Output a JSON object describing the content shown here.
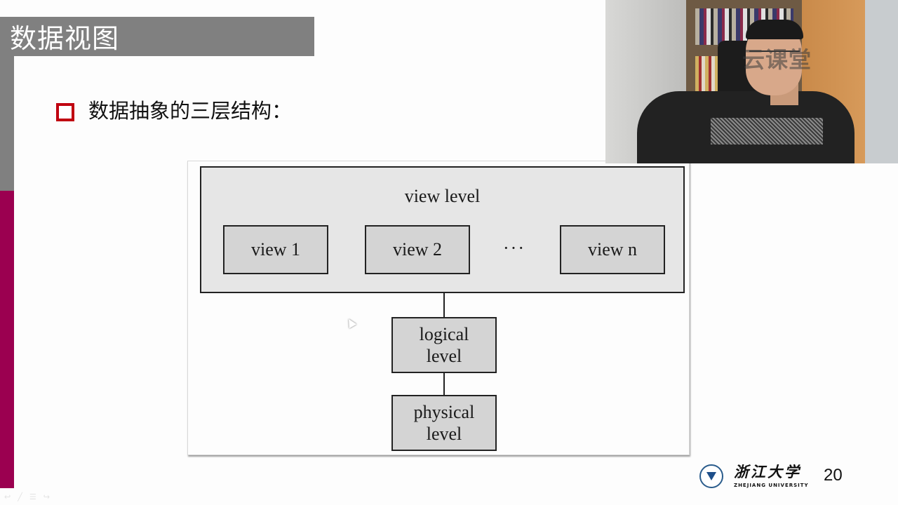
{
  "slide": {
    "title": "数据视图",
    "bullet": "数据抽象的三层结构：",
    "page_number": "20"
  },
  "figure": {
    "view_level_label": "view level",
    "views": [
      "view 1",
      "view 2",
      "view n"
    ],
    "ellipsis": "···",
    "logical_level": [
      "logical",
      "level"
    ],
    "physical_level": [
      "physical",
      "level"
    ]
  },
  "webcam": {
    "watermark": "云课堂"
  },
  "logo": {
    "name_cn": "浙江大学",
    "name_en": "ZHEJIANG UNIVERSITY"
  },
  "toolbar": {
    "icons": [
      "prev-arrow-icon",
      "pen-icon",
      "menu-icon",
      "next-arrow-icon"
    ],
    "glyphs": [
      "↩",
      "╱",
      "☰",
      "↪"
    ]
  },
  "colors": {
    "title_bar": "#808080",
    "accent_magenta": "#9b0050",
    "bullet_red": "#c00010",
    "view_level_fill": "#e6e6e6",
    "box_fill": "#d4d4d4"
  }
}
